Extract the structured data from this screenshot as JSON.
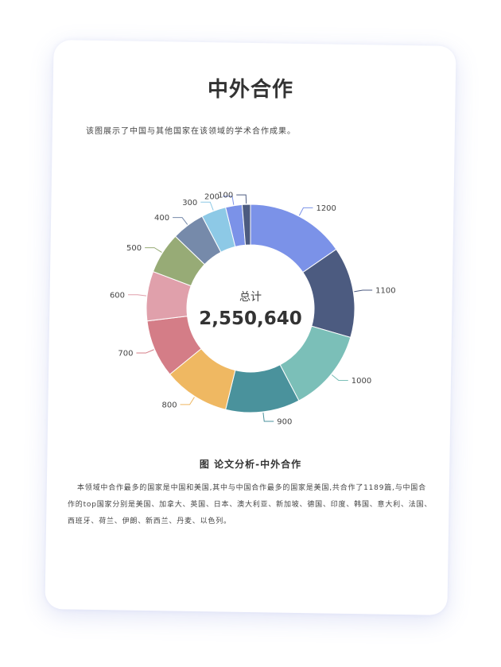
{
  "page": {
    "title": "中外合作",
    "subtitle": "该图展示了中国与其他国家在该领域的学术合作成果。",
    "caption": "图 论文分析-中外合作",
    "paragraph": "本领域中合作最多的国家是中国和美国,其中与中国合作最多的国家是美国,共合作了1189篇,与中国合作的top国家分别是美国、加拿大、英国、日本、澳大利亚、新加坡、德国、印度、韩国、意大利、法国、西班牙、荷兰、伊朗、新西兰、丹麦、以色列。"
  },
  "chart_data": {
    "type": "pie",
    "donut": true,
    "center_label": "总计",
    "center_value": "2,550,640",
    "categories": [
      "1200",
      "1100",
      "1000",
      "900",
      "800",
      "700",
      "600",
      "500",
      "400",
      "300",
      "200",
      "100"
    ],
    "values": [
      1200,
      1100,
      1000,
      900,
      800,
      700,
      600,
      500,
      400,
      300,
      200,
      100
    ],
    "colors": [
      "#7b92e8",
      "#4c5b80",
      "#7bbfb8",
      "#4a929c",
      "#efb862",
      "#d47d87",
      "#e0a0ab",
      "#97ab76",
      "#768aaa",
      "#8dc9e6"
    ],
    "direction": "clockwise",
    "start": "top"
  }
}
